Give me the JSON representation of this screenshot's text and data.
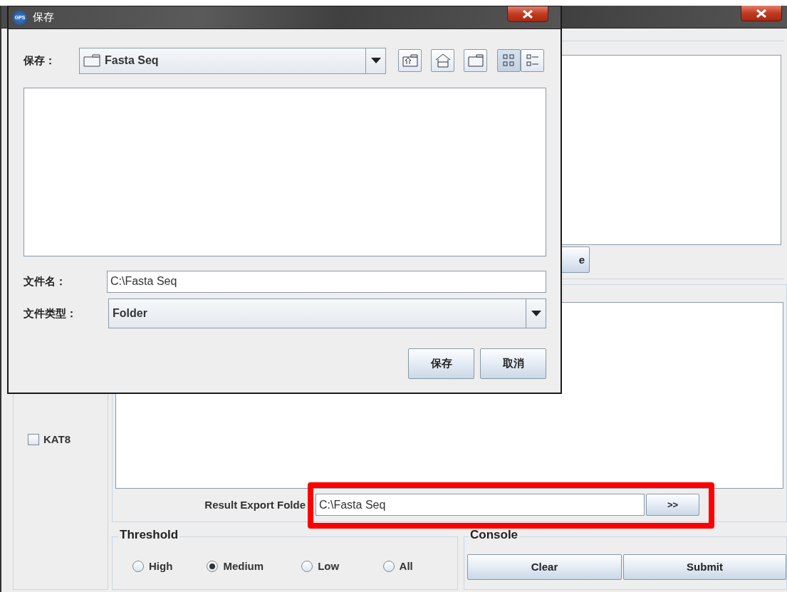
{
  "main_window": {
    "top_button": "e",
    "checkboxes": [
      {
        "label": "KAT8",
        "checked": false
      }
    ],
    "export": {
      "label": "Result Export Folde",
      "value": "C:\\Fasta Seq",
      "button": ">>"
    },
    "threshold": {
      "title": "Threshold",
      "options": [
        {
          "label": "High",
          "selected": false
        },
        {
          "label": "Medium",
          "selected": true
        },
        {
          "label": "Low",
          "selected": false
        },
        {
          "label": "All",
          "selected": false
        }
      ]
    },
    "console": {
      "title": "Console",
      "buttons": [
        "Clear",
        "Submit"
      ]
    }
  },
  "dialog": {
    "title": "保存",
    "app_badge": "GPS",
    "save_in": {
      "label": "保存：",
      "value": "Fasta Seq"
    },
    "nav_buttons": [
      {
        "kind": "up"
      },
      {
        "kind": "home"
      },
      {
        "kind": "new_folder"
      }
    ],
    "view_buttons": [
      {
        "kind": "icons",
        "selected": true
      },
      {
        "kind": "details",
        "selected": false
      }
    ],
    "file_name": {
      "label": "文件名：",
      "value": "C:\\Fasta Seq"
    },
    "file_type": {
      "label": "文件类型：",
      "value": "Folder"
    },
    "buttons": [
      "保存",
      "取消"
    ]
  }
}
